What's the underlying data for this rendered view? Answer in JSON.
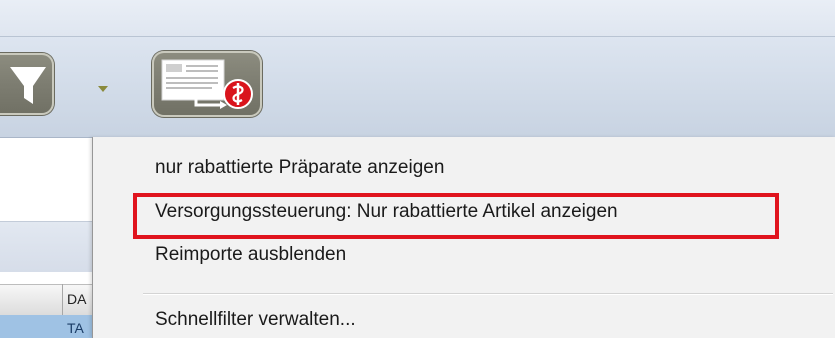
{
  "toolbar": {
    "filter_button": {
      "icon": "funnel-icon"
    },
    "dropdown_arrow": {
      "icon": "chevron-down-icon"
    },
    "document_button": {
      "icon": "document-pharmacy-icon",
      "badge_color": "#d9141c"
    }
  },
  "table": {
    "column_header": "DA",
    "selected_row_text": "TA"
  },
  "menu": {
    "items": [
      {
        "label": "nur rabattierte Präparate anzeigen"
      },
      {
        "label": "Versorgungssteuerung: Nur rabattierte Artikel anzeigen",
        "highlighted": true
      },
      {
        "label": "Reimporte ausblenden"
      },
      {
        "label": "Schnellfilter verwalten..."
      }
    ]
  },
  "colors": {
    "highlight_border": "#e0141e",
    "button_face": "#7d7d71",
    "selection": "#9fc2e4"
  }
}
